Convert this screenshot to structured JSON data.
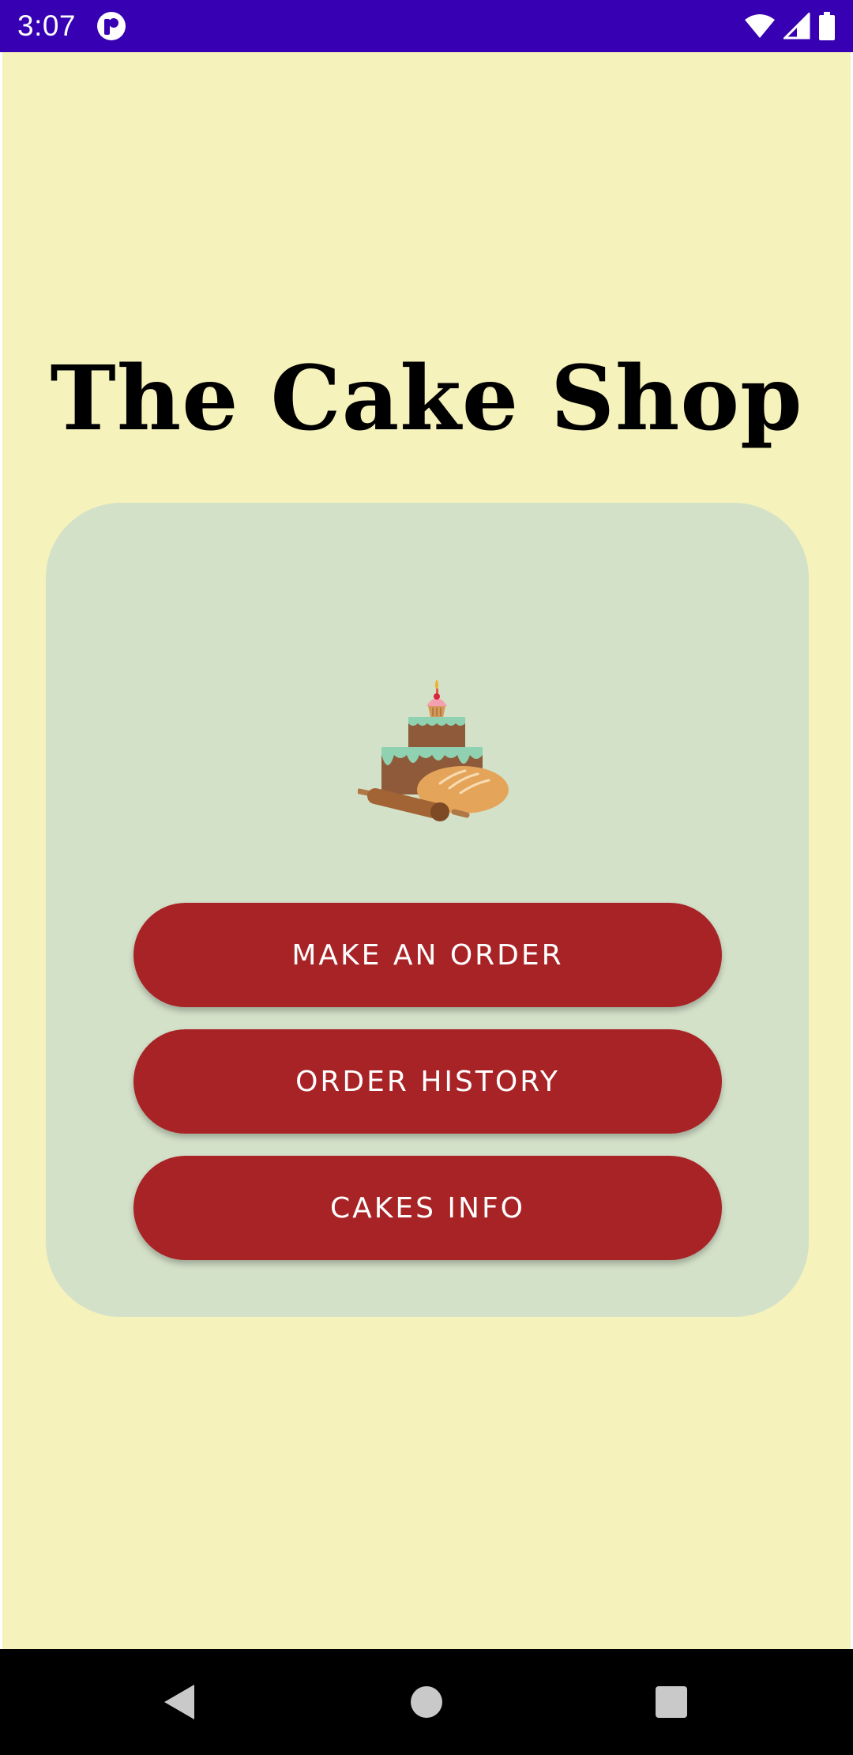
{
  "status_bar": {
    "time": "3:07",
    "background_color": "#3700b3",
    "icons": [
      "app-notification-icon",
      "wifi-icon",
      "signal-icon",
      "battery-icon"
    ]
  },
  "app": {
    "background_color": "#f5f2bb",
    "title": "The Cake Shop",
    "card": {
      "background_color": "#d4e1c9",
      "illustration": "cake-bread-rolling-pin-illustration"
    },
    "buttons": [
      {
        "id": "make_order",
        "label": "MAKE AN ORDER"
      },
      {
        "id": "order_history",
        "label": "ORDER HISTORY"
      },
      {
        "id": "cakes_info",
        "label": "CAKES INFO"
      }
    ],
    "button_color": "#a82326"
  },
  "nav_bar": {
    "icons": [
      "back-icon",
      "home-icon",
      "recents-icon"
    ]
  }
}
